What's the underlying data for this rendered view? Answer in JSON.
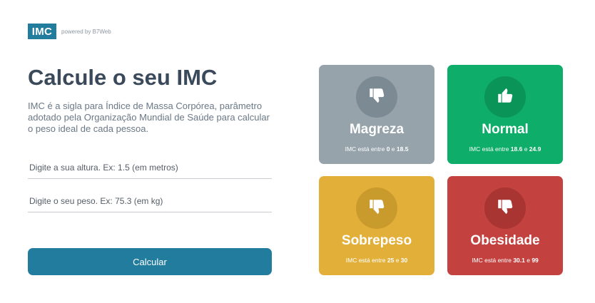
{
  "header": {
    "logo_text": "IMC",
    "powered_by": "powered by B7Web"
  },
  "main": {
    "title": "Calcule o seu IMC",
    "description": "IMC é a sigla para Índice de Massa Corpórea, parâmetro adotado pela Organização Mundial de Saúde para calcular o peso ideal de cada pessoa.",
    "height_input": {
      "placeholder": "Digite a sua altura. Ex: 1.5 (em metros)",
      "value": ""
    },
    "weight_input": {
      "placeholder": "Digite o seu peso. Ex: 75.3 (em kg)",
      "value": ""
    },
    "calculate_label": "Calcular"
  },
  "levels": [
    {
      "title": "Magreza",
      "range_prefix": "IMC está entre ",
      "min": "0",
      "sep": " e ",
      "max": "18.5",
      "color": "#96a3ab",
      "icon_bg": "#7c8a93",
      "icon": "thumbs-down-icon"
    },
    {
      "title": "Normal",
      "range_prefix": "IMC está entre ",
      "min": "18.6",
      "sep": " e ",
      "max": "24.9",
      "color": "#0ead69",
      "icon_bg": "#0b9458",
      "icon": "thumbs-up-icon"
    },
    {
      "title": "Sobrepeso",
      "range_prefix": "IMC está entre ",
      "min": "25",
      "sep": " e ",
      "max": "30",
      "color": "#e2b039",
      "icon_bg": "#c99a2c",
      "icon": "thumbs-down-icon"
    },
    {
      "title": "Obesidade",
      "range_prefix": "IMC está entre ",
      "min": "30.1",
      "sep": " e ",
      "max": "99",
      "color": "#c3423f",
      "icon_bg": "#a93532",
      "icon": "thumbs-down-icon"
    }
  ]
}
